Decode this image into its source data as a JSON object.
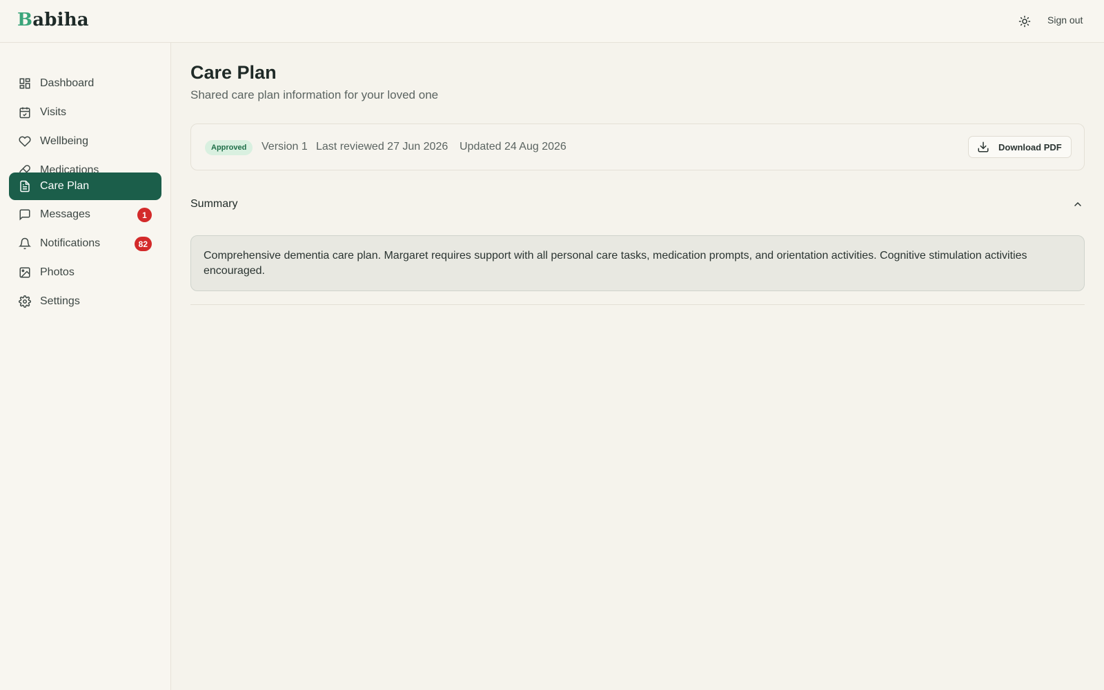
{
  "app": {
    "logo_initial": "B",
    "logo_rest": "abiha",
    "sign_out_label": "Sign out"
  },
  "sidebar": {
    "items": [
      {
        "label": "Dashboard",
        "icon": "dashboard-icon"
      },
      {
        "label": "Visits",
        "icon": "calendar-check-icon"
      },
      {
        "label": "Wellbeing",
        "icon": "heart-icon"
      },
      {
        "label": "Medications",
        "icon": "pill-icon"
      },
      {
        "label": "Care Plan",
        "icon": "document-icon",
        "active": true
      },
      {
        "label": "Messages",
        "icon": "message-icon",
        "badge": "1"
      },
      {
        "label": "Notifications",
        "icon": "bell-icon",
        "badge": "82"
      },
      {
        "label": "Photos",
        "icon": "image-icon"
      },
      {
        "label": "Settings",
        "icon": "gear-icon"
      }
    ]
  },
  "page": {
    "title": "Care Plan",
    "subtitle": "Shared care plan information for your loved one"
  },
  "info": {
    "status": "Approved",
    "version": "Version 1",
    "last_reviewed": "Last reviewed 27 Jun 2026",
    "updated": "Updated 24 Aug 2026",
    "download_label": "Download PDF"
  },
  "summary": {
    "title": "Summary",
    "text": "Comprehensive dementia care plan. Margaret requires support with all personal care tasks, medication prompts, and orientation activities. Cognitive stimulation activities encouraged."
  },
  "colors": {
    "accent": "#1b5e4a",
    "logo_accent": "#3aa57a",
    "badge_red": "#d32a2a",
    "approved_bg": "#d9f0e0"
  }
}
